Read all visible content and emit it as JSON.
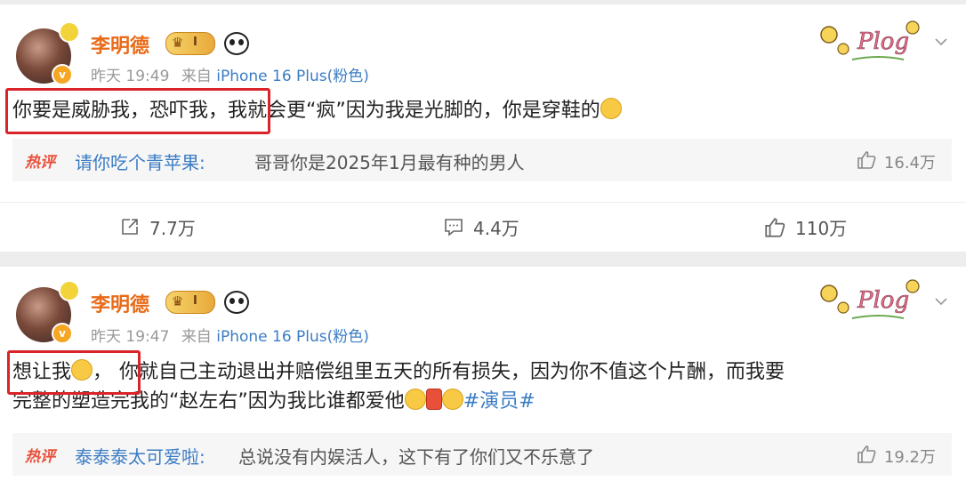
{
  "post1": {
    "author": "李明德",
    "vip_level": "I",
    "time": "昨天 19:49",
    "source_prefix": "来自",
    "source": "iPhone 16 Plus(粉色)",
    "text_highlight": "你要是威胁我，恐吓我，",
    "text_rest": "我就会更“疯”因为我是光脚的，你是穿鞋的",
    "hot_badge": "热评",
    "hot_user": "请你吃个青苹果:",
    "hot_text": "哥哥你是2025年1月最有种的男人",
    "hot_likes": "16.4万",
    "reposts": "7.7万",
    "comments": "4.4万",
    "likes": "110万"
  },
  "post2": {
    "author": "李明德",
    "vip_level": "I",
    "time": "昨天 19:47",
    "source_prefix": "来自",
    "source": "iPhone 16 Plus(粉色)",
    "text_highlight": "想让我",
    "text_comma": "，",
    "text_line1_rest": "你就自己主动退出并赔偿组里五天的所有损失，因为你不值这个片酬，而我要",
    "text_line2": "完整的塑造完我的“赵左右”因为我比谁都爱他",
    "hashtag": "#演员#",
    "hot_badge": "热评",
    "hot_user": "泰泰泰太可爱啦:",
    "hot_text": "总说没有内娱活人，这下有了你们又不乐意了",
    "hot_likes": "19.2万"
  },
  "decor": {
    "plog_text": "Plog"
  },
  "colors": {
    "author": "#e86b1a",
    "link": "#3b7cc4",
    "highlight_box": "#d9242a",
    "hot_badge": "#e8503a"
  },
  "icons": [
    "verified-v-icon",
    "vip-crown-icon",
    "panda-icon",
    "plog-sticker",
    "chevron-down-icon",
    "repost-icon",
    "comment-icon",
    "like-icon",
    "thumb-up-icon",
    "grin-emoji",
    "sweat-emoji",
    "gift-emoji"
  ]
}
